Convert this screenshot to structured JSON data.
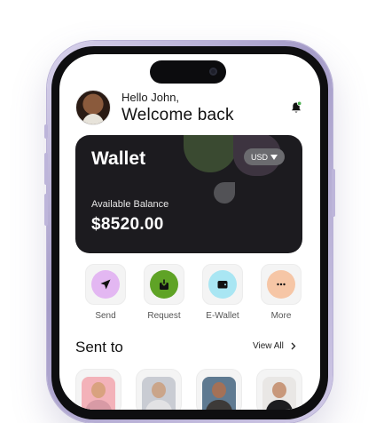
{
  "header": {
    "greeting": "Hello John,",
    "welcome": "Welcome back"
  },
  "wallet": {
    "title": "Wallet",
    "currency": "USD",
    "balance_label": "Available Balance",
    "balance": "$8520.00"
  },
  "actions": [
    {
      "label": "Send",
      "icon": "send-icon",
      "color": "#e3b7f2"
    },
    {
      "label": "Request",
      "icon": "download-icon",
      "color": "#5fa326"
    },
    {
      "label": "E-Wallet",
      "icon": "wallet-icon",
      "color": "#a9e6f3"
    },
    {
      "label": "More",
      "icon": "more-icon",
      "color": "#f6c6a6"
    }
  ],
  "sent_to": {
    "title": "Sent to",
    "view_all": "View All"
  },
  "colors": {
    "card_bg": "#1c1b1f",
    "notification_dot": "#4caf50"
  }
}
